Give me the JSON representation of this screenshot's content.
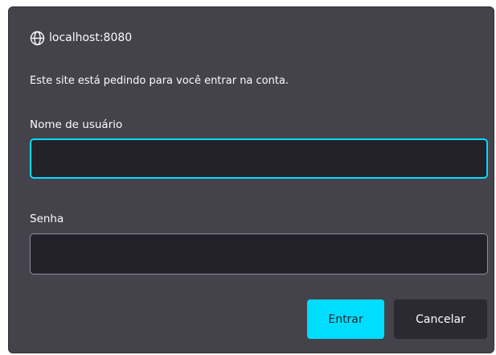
{
  "dialog": {
    "origin": "localhost:8080",
    "message": "Este site está pedindo para você entrar na conta.",
    "username_label": "Nome de usuário",
    "username_value": "",
    "password_label": "Senha",
    "password_value": "",
    "submit_label": "Entrar",
    "cancel_label": "Cancelar",
    "origin_icon": "globe-icon"
  },
  "colors": {
    "dialog_background": "#44434b",
    "field_background": "#23222b",
    "accent": "#00ddff",
    "text": "#fbfbfe"
  }
}
